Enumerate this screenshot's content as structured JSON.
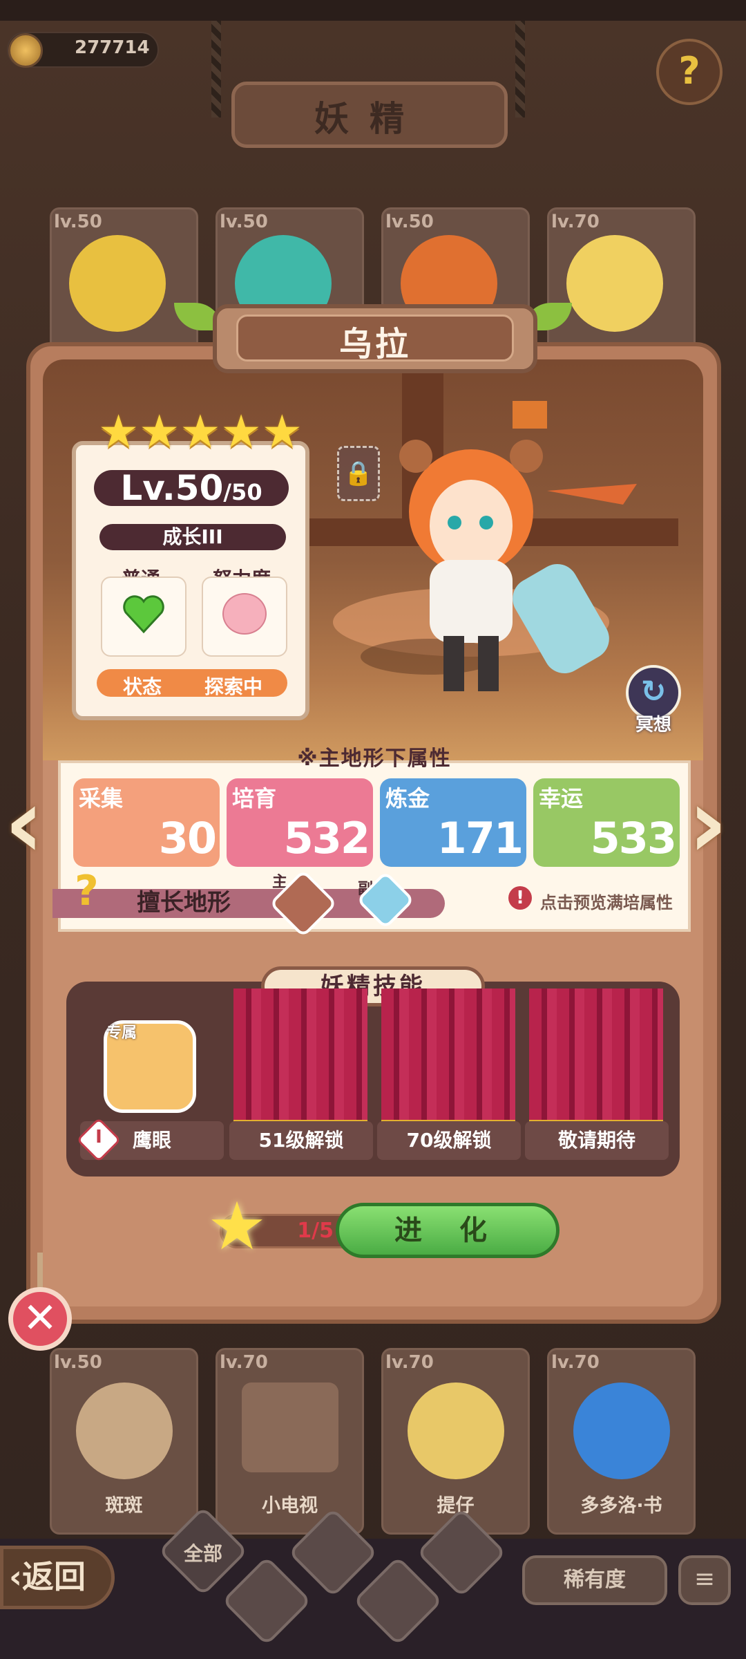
{
  "header": {
    "coins": "277714",
    "title": "妖精"
  },
  "top_cards": [
    {
      "level": "lv.50"
    },
    {
      "level": "lv.50"
    },
    {
      "level": "lv.50"
    },
    {
      "level": "lv.70"
    }
  ],
  "fairy": {
    "name": "乌拉",
    "stars": 5,
    "level_current": "Lv.50",
    "level_max": "/50",
    "growth": "成长III",
    "mood_label": "普通",
    "effort_label": "努力度",
    "status_label": "状态",
    "status_value": "探索中",
    "meditate_label": "冥想"
  },
  "attributes": {
    "heading": "※主地形下属性",
    "items": [
      {
        "name": "采集",
        "value": "30",
        "color": "#f4a07c"
      },
      {
        "name": "培育",
        "value": "532",
        "color": "#ec7a94"
      },
      {
        "name": "炼金",
        "value": "171",
        "color": "#5aa0dc"
      },
      {
        "name": "幸运",
        "value": "533",
        "color": "#98c864"
      }
    ],
    "terrain_label": "擅长地形",
    "main_tag": "主",
    "sub_tag": "副",
    "preview_hint": "点击预览满培属性"
  },
  "skills": {
    "heading": "妖精技能",
    "exclusive_tag": "专属",
    "slots": [
      {
        "label": "鹰眼",
        "badge": "I"
      },
      {
        "label": "51级解锁"
      },
      {
        "label": "70级解锁"
      },
      {
        "label": "敬请期待"
      }
    ]
  },
  "evolve": {
    "progress": "1/5",
    "button": "进 化"
  },
  "bottom_cards": [
    {
      "level": "lv.50",
      "name": "斑斑"
    },
    {
      "level": "lv.70",
      "name": "小电视"
    },
    {
      "level": "lv.70",
      "name": "提仔"
    },
    {
      "level": "lv.70",
      "name": "多多洛·书"
    }
  ],
  "nav": {
    "back": "返回",
    "all": "全部",
    "rarity": "稀有度"
  }
}
